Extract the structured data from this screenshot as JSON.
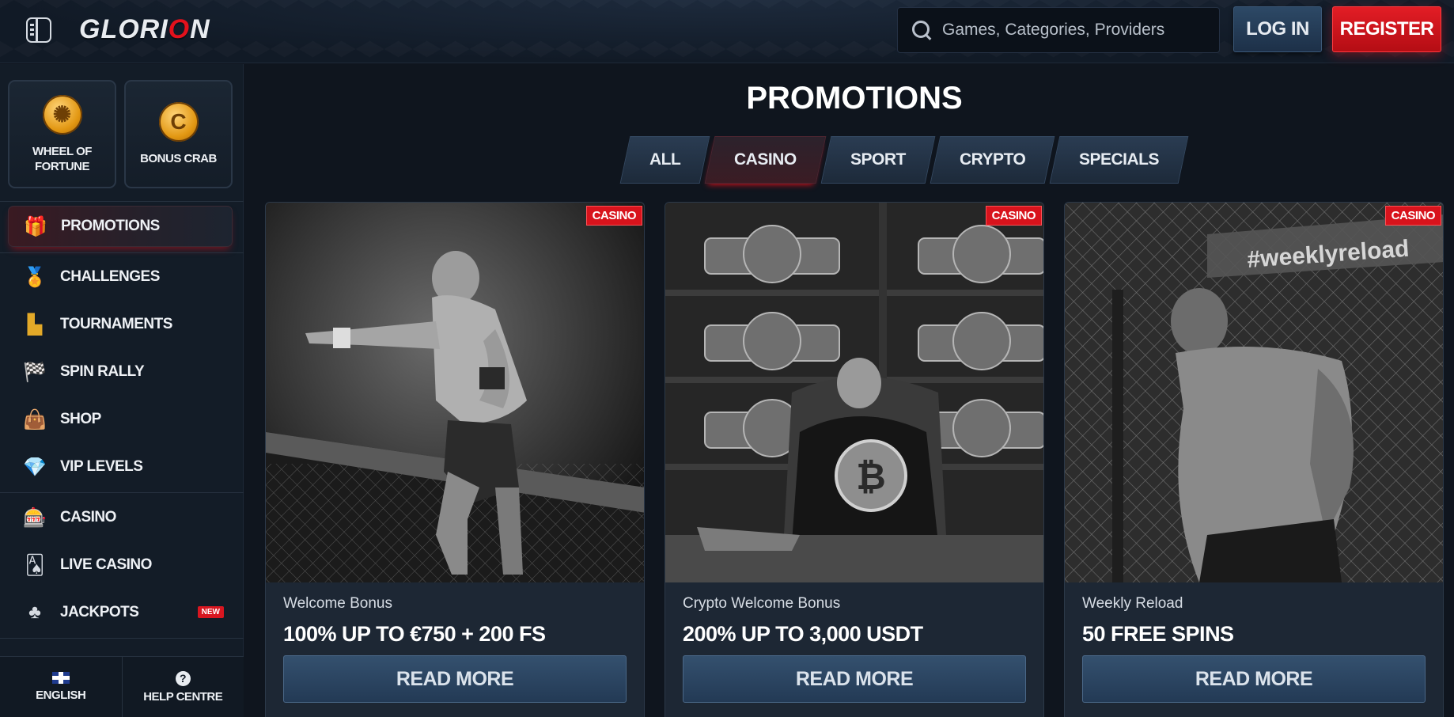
{
  "header": {
    "logo_left": "GLORI",
    "logo_accent": "O",
    "logo_right": "N",
    "search_placeholder": "Games, Categories, Providers",
    "login_label": "LOG IN",
    "register_label": "REGISTER"
  },
  "sidebar": {
    "tiles": [
      {
        "label": "WHEEL OF FORTUNE",
        "icon": "wheel-icon"
      },
      {
        "label": "BONUS CRAB",
        "icon": "crab-claw-icon"
      }
    ],
    "items": [
      {
        "label": "PROMOTIONS",
        "icon": "gift-icon",
        "active": true
      },
      {
        "label": "CHALLENGES",
        "icon": "medal-icon"
      },
      {
        "label": "TOURNAMENTS",
        "icon": "podium-icon"
      },
      {
        "label": "SPIN RALLY",
        "icon": "checkered-flag-icon"
      },
      {
        "label": "SHOP",
        "icon": "shopping-bag-icon"
      },
      {
        "label": "VIP LEVELS",
        "icon": "diamond-icon"
      },
      {
        "label": "CASINO",
        "icon": "slot-machine-icon"
      },
      {
        "label": "LIVE CASINO",
        "icon": "playing-card-icon"
      },
      {
        "label": "JACKPOTS",
        "icon": "clover-icon",
        "badge": "NEW"
      }
    ],
    "footer": {
      "language_label": "ENGLISH",
      "help_label": "HELP CENTRE"
    }
  },
  "main": {
    "title": "PROMOTIONS",
    "filters": [
      "ALL",
      "CASINO",
      "SPORT",
      "CRYPTO",
      "SPECIALS"
    ],
    "active_filter": "CASINO",
    "cards": [
      {
        "badge": "CASINO",
        "subtitle": "Welcome Bonus",
        "title": "100% UP TO €750 + 200 FS",
        "button": "READ MORE"
      },
      {
        "badge": "CASINO",
        "subtitle": "Crypto Welcome Bonus",
        "title": "200% UP TO 3,000 USDT",
        "button": "READ MORE"
      },
      {
        "badge": "CASINO",
        "subtitle": "Weekly Reload",
        "title": "50 FREE SPINS",
        "button": "READ MORE",
        "image_caption": "#weeklyreload"
      }
    ]
  },
  "colors": {
    "accent_red": "#e3111c",
    "button_blue": "#2d4966",
    "background": "#0f151e"
  }
}
